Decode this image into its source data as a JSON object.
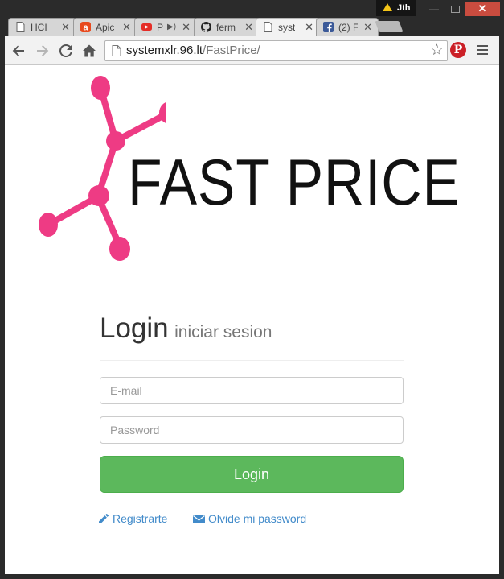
{
  "window": {
    "user_name": "Jth",
    "colors": {
      "frame": "#2b2b2b",
      "close_button": "#c94c3f"
    }
  },
  "tabs": [
    {
      "title": "HCI",
      "icon": "page-icon",
      "active": false
    },
    {
      "title": "Apic",
      "icon": "app-icon",
      "active": false
    },
    {
      "title": "P",
      "icon": "youtube-icon",
      "active": false,
      "audio": true
    },
    {
      "title": "ferm",
      "icon": "github-icon",
      "active": false
    },
    {
      "title": "syst",
      "icon": "page-icon",
      "active": true
    },
    {
      "title": "(2) F",
      "icon": "facebook-icon",
      "active": false
    }
  ],
  "toolbar": {
    "url_host": "systemxlr.96.lt",
    "url_path": "/FastPrice/"
  },
  "page": {
    "logo_text": "FAST PRICE",
    "login_title": "Login",
    "login_subtitle": "iniciar sesion",
    "email_placeholder": "E-mail",
    "password_placeholder": "Password",
    "login_button": "Login",
    "register_link": "Registrarte",
    "forgot_link": "Olvide mi password",
    "colors": {
      "logo_accent": "#ee3b84",
      "login_button": "#5cb85c",
      "link": "#428bca"
    }
  }
}
